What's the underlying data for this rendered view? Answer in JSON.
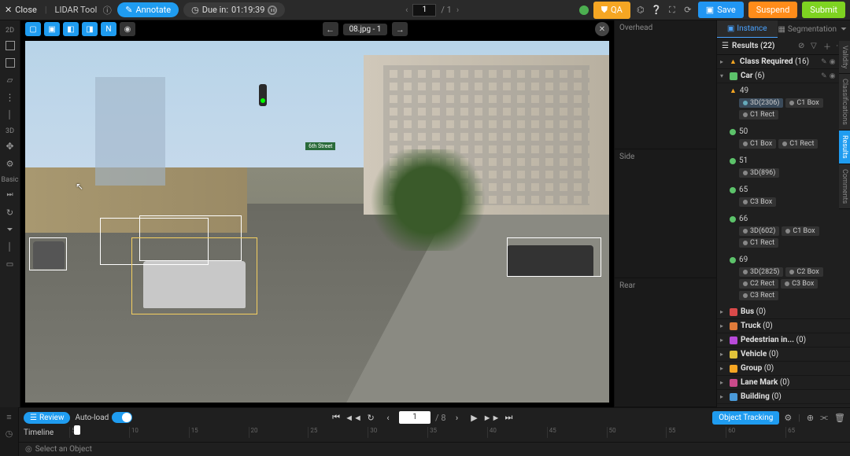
{
  "topbar": {
    "close": "Close",
    "tool": "LIDAR Tool",
    "annotate": "Annotate",
    "due_label": "Due in:",
    "due_time": "01:19:39",
    "page_current": "1",
    "page_total": "/ 1",
    "qa": "QA",
    "save": "Save",
    "suspend": "Suspend",
    "submit": "Submit"
  },
  "canvas": {
    "filename": "08.jpg - 1",
    "street_sign": "6th  Street"
  },
  "panes": {
    "overhead": "Overhead",
    "side": "Side",
    "rear": "Rear"
  },
  "tabs": {
    "instance": "Instance",
    "segmentation": "Segmentation"
  },
  "results": {
    "title": "Results (22)",
    "class_required": "Class Required",
    "class_required_count": "(16)",
    "car": "Car",
    "car_count": "(6)",
    "bus": "Bus",
    "bus_count": "(0)",
    "truck": "Truck",
    "truck_count": "(0)",
    "ped": "Pedestrian in...",
    "ped_count": "(0)",
    "vehicle": "Vehicle",
    "vehicle_count": "(0)",
    "group": "Group",
    "group_count": "(0)",
    "lane": "Lane Mark",
    "lane_count": "(0)",
    "building": "Building",
    "building_count": "(0)"
  },
  "instances": {
    "i49": {
      "id": "49",
      "c1": "3D(2306)",
      "c2": "C1 Box",
      "c3": "C1 Rect"
    },
    "i50": {
      "id": "50",
      "c1": "C1 Box",
      "c2": "C1 Rect"
    },
    "i51": {
      "id": "51",
      "c1": "3D(896)"
    },
    "i65": {
      "id": "65",
      "c1": "C3 Box"
    },
    "i66": {
      "id": "66",
      "c1": "3D(602)",
      "c2": "C1 Box",
      "c3": "C1 Rect"
    },
    "i69": {
      "id": "69",
      "c1": "3D(2825)",
      "c2": "C2 Box",
      "c3": "C2 Rect",
      "c4": "C3 Box",
      "c5": "C3 Rect"
    }
  },
  "vtabs": {
    "validity": "Validity",
    "classifications": "Classifications",
    "results": "Results",
    "comments": "Comments"
  },
  "playback": {
    "review": "Review",
    "autoload": "Auto-load",
    "frame": "1",
    "total": "/ 8",
    "tracking": "Object Tracking"
  },
  "timeline": {
    "label": "Timeline",
    "select": "Select an Object",
    "ticks": [
      "5",
      "10",
      "15",
      "20",
      "25",
      "30",
      "35",
      "40",
      "45",
      "50",
      "55",
      "60",
      "65"
    ]
  }
}
